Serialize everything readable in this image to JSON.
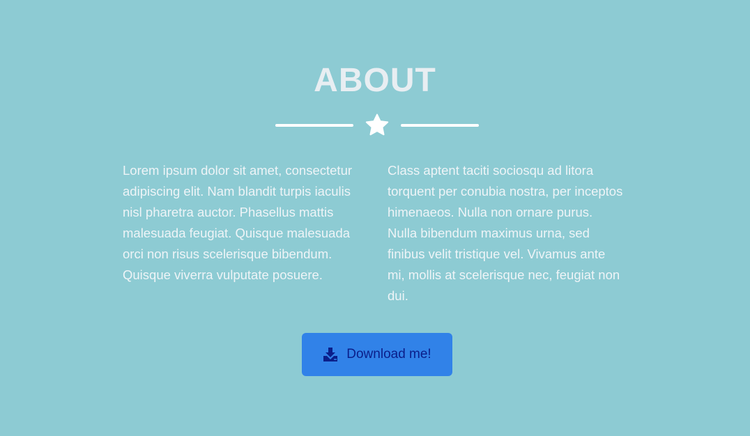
{
  "about": {
    "title": "ABOUT",
    "divider_icon": "star-icon",
    "paragraph_1": "Lorem ipsum dolor sit amet, consectetur adipiscing elit. Nam blandit turpis iaculis nisl pharetra auctor. Phasellus mattis malesuada feugiat. Quisque malesuada orci non risus scelerisque bibendum. Quisque viverra vulputate posuere.",
    "paragraph_2": "Class aptent taciti sociosqu ad litora torquent per conubia nostra, per inceptos himenaeos. Nulla non ornare purus. Nulla bibendum maximus urna, sed finibus velit tristique vel. Vivamus ante mi, mollis at scelerisque nec, feugiat non dui."
  },
  "download_button": {
    "label": "Download me!",
    "icon": "download-icon"
  },
  "colors": {
    "background": "#8dcbd3",
    "title": "#e8eef2",
    "text": "#eef4f7",
    "divider": "#ffffff",
    "button_background": "#3182e8",
    "button_text": "#0b1f8a"
  }
}
